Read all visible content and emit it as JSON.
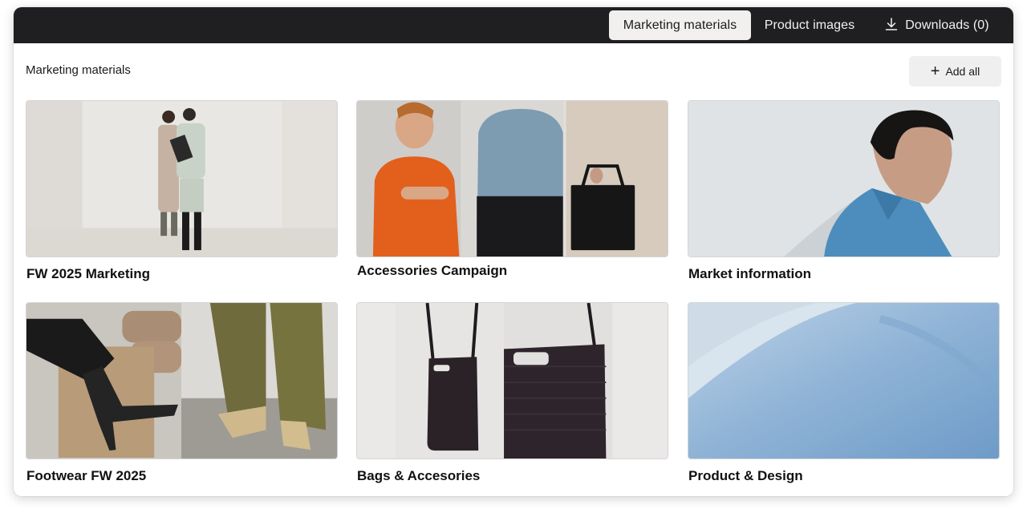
{
  "topbar": {
    "tabs": [
      {
        "label": "Marketing materials",
        "active": true
      },
      {
        "label": "Product images",
        "active": false
      },
      {
        "label": "Downloads (0)",
        "icon": "download-icon",
        "active": false
      }
    ]
  },
  "section": {
    "title": "Marketing materials",
    "add_all_label": "Add all",
    "add_all_icon": "plus-icon"
  },
  "cards": [
    {
      "title": "FW 2025 Marketing"
    },
    {
      "title": "Accessories Campaign"
    },
    {
      "title": "Market information"
    },
    {
      "title": "Footwear FW 2025"
    },
    {
      "title": "Bags & Accesories"
    },
    {
      "title": "Product & Design"
    }
  ],
  "colors": {
    "topbar_bg": "#1f1e20",
    "active_tab_bg": "#f1f0ee",
    "button_bg": "#efeff0"
  }
}
